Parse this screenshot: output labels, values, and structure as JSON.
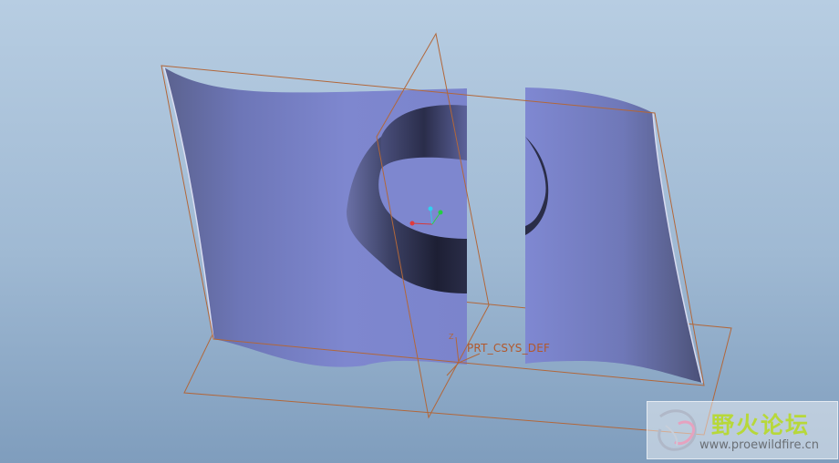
{
  "viewport": {
    "csys_label": "PRT_CSYS_DEF",
    "axis_z_label": "Z",
    "surface_color": "#7e87cf",
    "datum_color": "#b2673a"
  },
  "watermark": {
    "title": "野火论坛",
    "url": "www.proewildfire.cn"
  }
}
